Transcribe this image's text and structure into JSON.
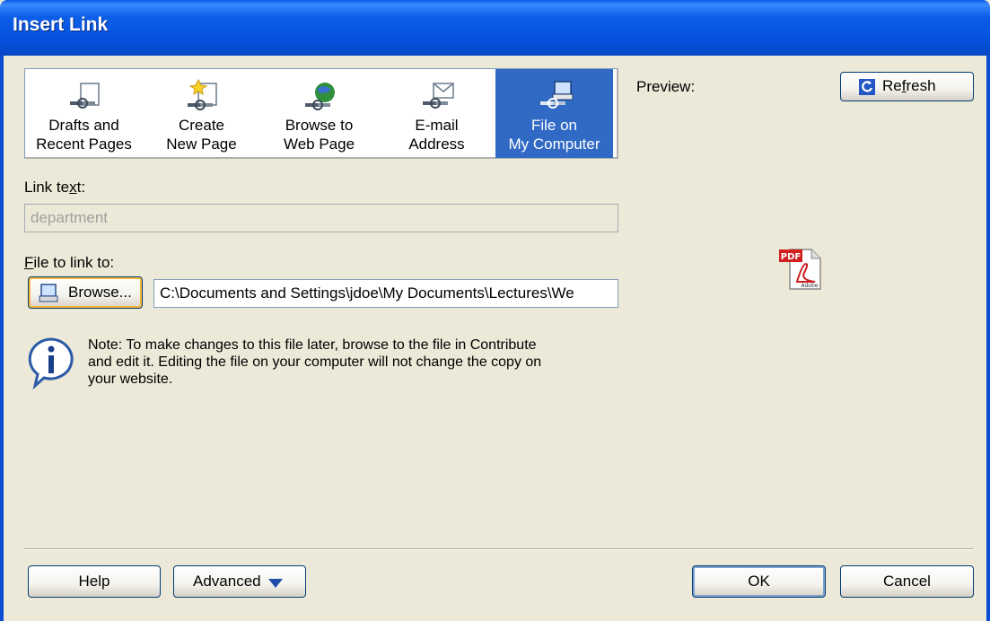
{
  "window": {
    "title": "Insert Link"
  },
  "tabs": [
    {
      "line1": "Drafts and",
      "line2": "Recent Pages",
      "icon": "drafts-link-icon",
      "selected": false
    },
    {
      "line1": "Create",
      "line2": "New Page",
      "icon": "new-page-link-icon",
      "selected": false
    },
    {
      "line1": "Browse to",
      "line2": "Web Page",
      "icon": "web-globe-link-icon",
      "selected": false
    },
    {
      "line1": "E-mail",
      "line2": "Address",
      "icon": "email-link-icon",
      "selected": false
    },
    {
      "line1": "File on",
      "line2": "My Computer",
      "icon": "computer-link-icon",
      "selected": true
    }
  ],
  "link_text": {
    "label_pre": "Link te",
    "label_accel": "x",
    "label_post": "t:",
    "value": "department"
  },
  "file_link": {
    "label_accel": "F",
    "label_post": "ile to link to:",
    "browse_label": "Browse...",
    "path": "C:\\Documents and Settings\\jdoe\\My Documents\\Lectures\\We"
  },
  "note": {
    "text": "Note: To make changes to this file later, browse to the file in Contribute and edit it.  Editing the file on your computer will not change the copy on your website."
  },
  "preview": {
    "label": "Preview:",
    "refresh_pre": "Re",
    "refresh_accel": "f",
    "refresh_post": "resh",
    "file_icon_text": "PDF",
    "file_icon_sub": "Adobe"
  },
  "footer": {
    "help_label": "Help",
    "advanced_label": "Advanced",
    "ok_label": "OK",
    "cancel_label": "Cancel"
  },
  "colors": {
    "titlebar": "#0652de",
    "selected_tab": "#316ac5",
    "dialog_bg": "#ece9d8"
  }
}
